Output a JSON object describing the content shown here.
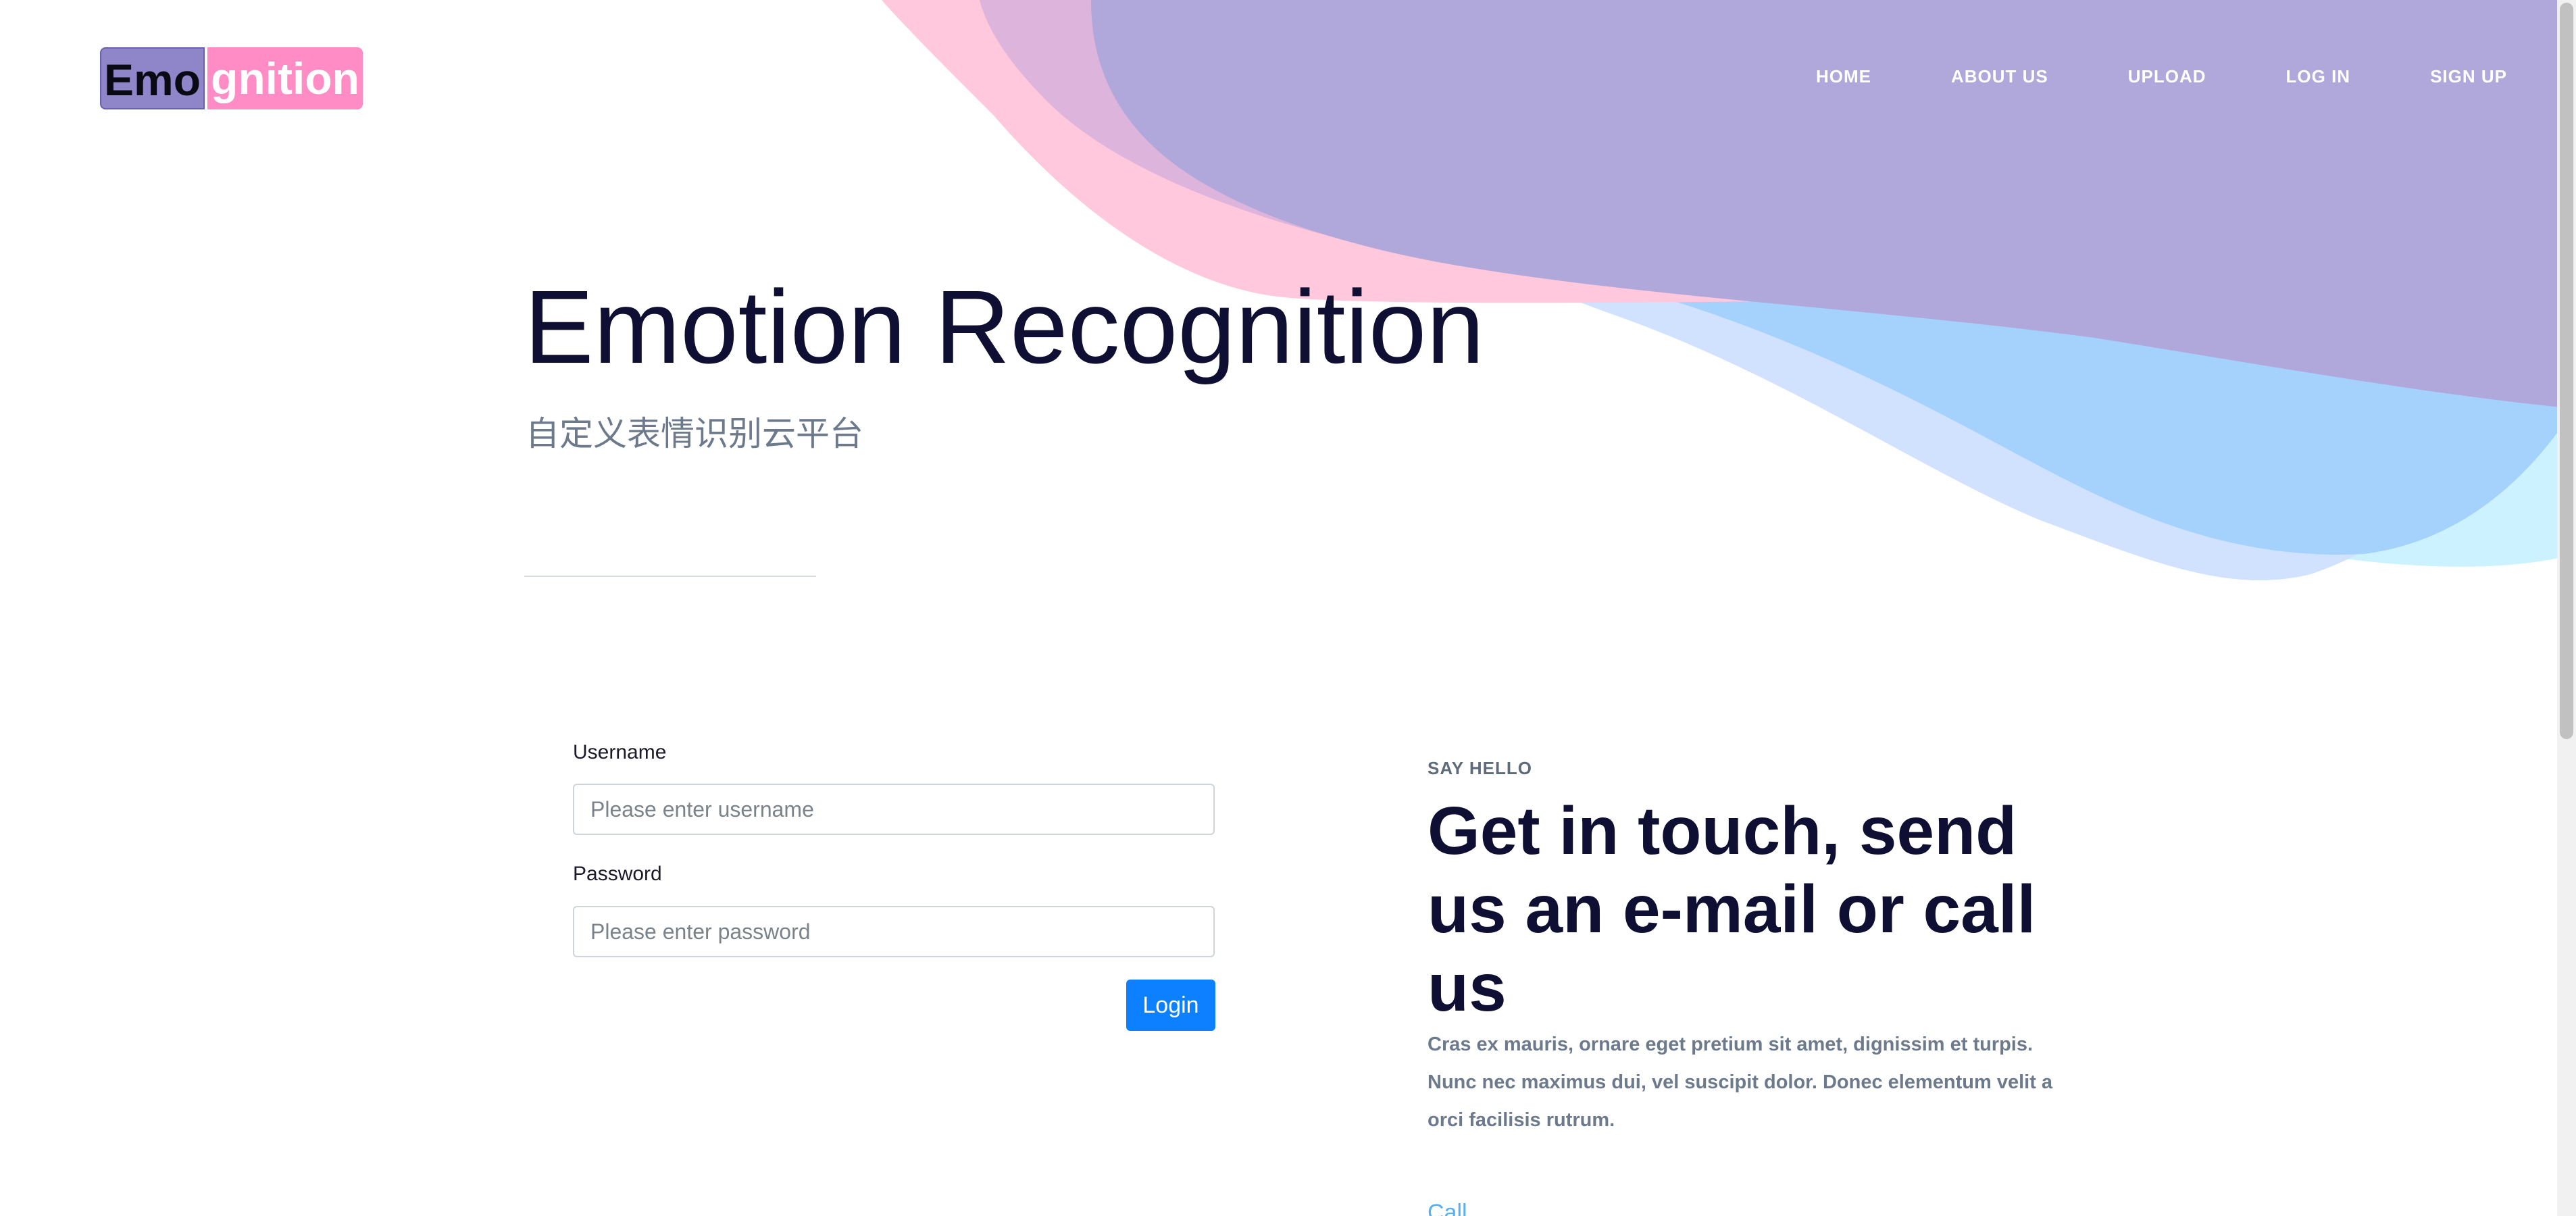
{
  "logo": {
    "part_a": "Emo",
    "part_b": "gnition"
  },
  "nav": {
    "items": [
      {
        "label": "HOME"
      },
      {
        "label": "ABOUT US"
      },
      {
        "label": "UPLOAD"
      },
      {
        "label": "LOG IN"
      },
      {
        "label": "SIGN UP"
      }
    ]
  },
  "hero": {
    "title": "Emotion Recognition",
    "subtitle": "自定义表情识别云平台"
  },
  "login_form": {
    "username_label": "Username",
    "username_placeholder": "Please enter username",
    "username_value": "",
    "password_label": "Password",
    "password_placeholder": "Please enter password",
    "password_value": "",
    "submit_label": "Login"
  },
  "contact": {
    "kicker": "SAY HELLO",
    "heading": "Get in touch, send us an e-mail or call us",
    "body": "Cras ex mauris, ornare eget pretium sit amet, dignissim et turpis. Nunc nec maximus dui, vel suscipit dolor. Donec elementum velit a orci facilisis rutrum.",
    "link_partial": "Call"
  },
  "colors": {
    "wave_pink": "#ffc8dc",
    "wave_mauve": "#dcb4dc",
    "wave_purple": "#b0a8da",
    "wave_light_blue": "#d0e2ff",
    "wave_blue": "#a4d2fc",
    "wave_cyan": "#ccf2ff",
    "logo_purple": "#8e86c9",
    "logo_pink": "#ff8cc4",
    "title_navy": "#0e0f33",
    "button_blue": "#0d80ff"
  }
}
